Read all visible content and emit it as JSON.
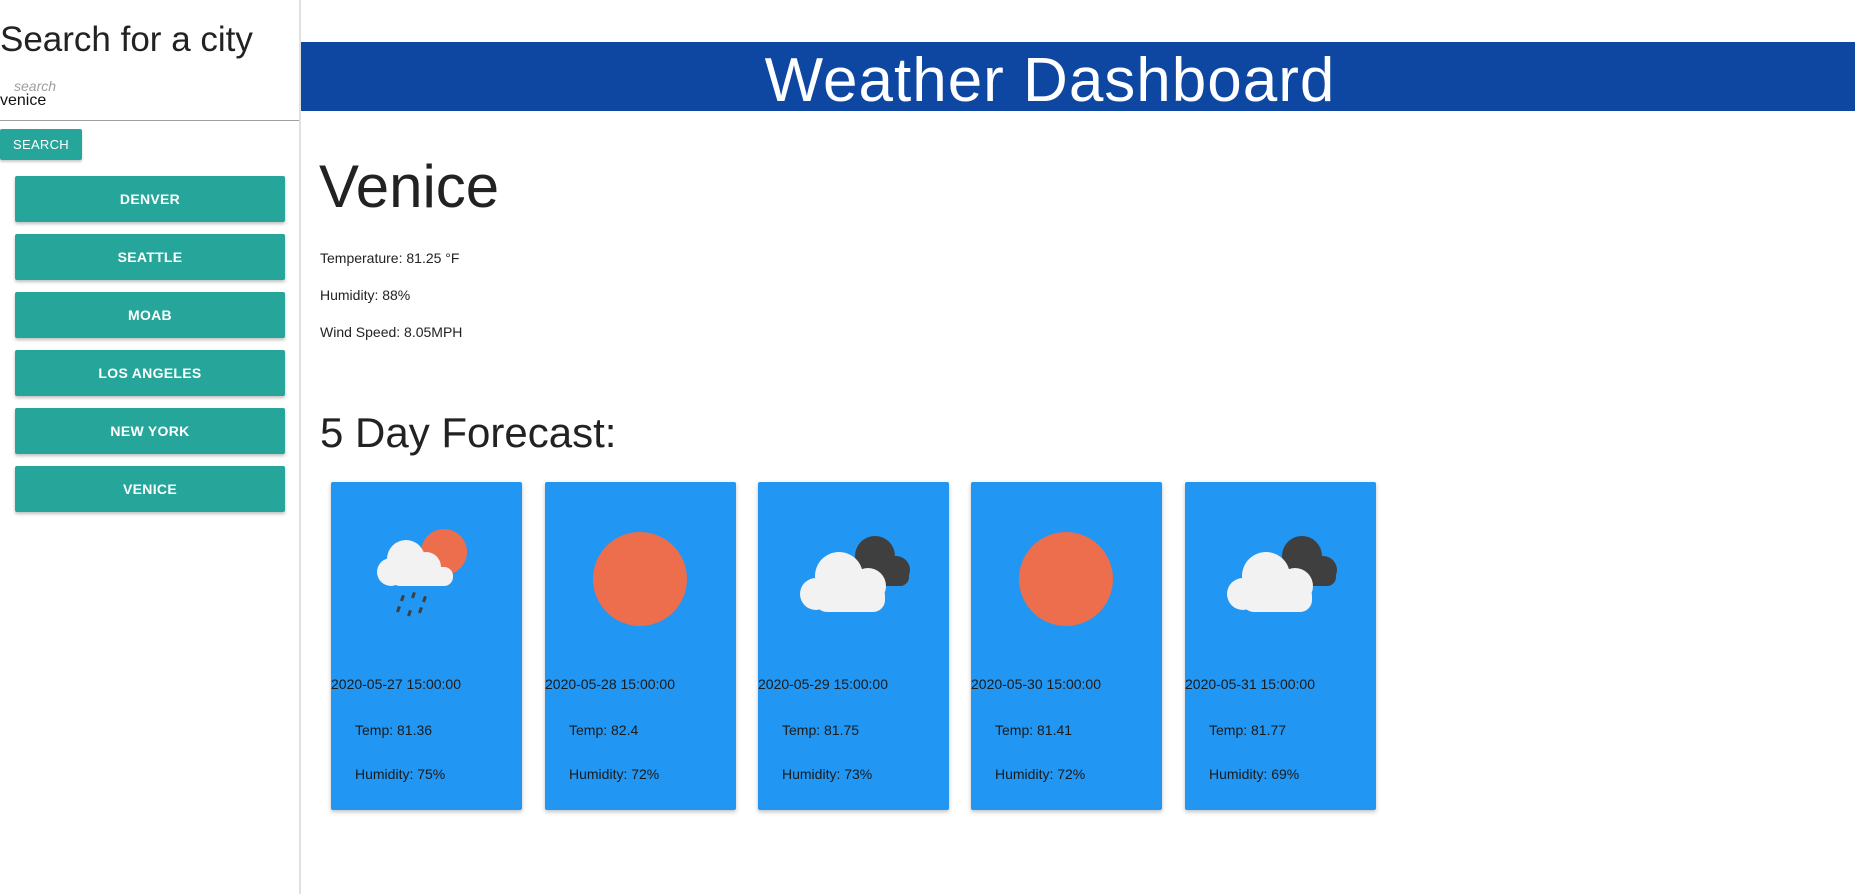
{
  "sidebar": {
    "title": "Search for a city",
    "search": {
      "placeholder": "search",
      "value": "venice"
    },
    "search_button": "SEARCH",
    "cities": [
      "DENVER",
      "SEATTLE",
      "MOAB",
      "LOS ANGELES",
      "NEW YORK",
      "VENICE"
    ]
  },
  "header": {
    "title": "Weather Dashboard"
  },
  "current": {
    "city": "Venice",
    "temperature": "Temperature: 81.25 °F",
    "humidity": "Humidity: 88%",
    "wind": "Wind Speed: 8.05MPH"
  },
  "forecast": {
    "title": "5 Day Forecast:",
    "days": [
      {
        "icon": "rain-cloud-sun-icon",
        "date": "2020-05-27 15:00:00",
        "temp": "Temp: 81.36",
        "humidity": "Humidity: 75%"
      },
      {
        "icon": "sun-icon",
        "date": "2020-05-28 15:00:00",
        "temp": "Temp: 82.4",
        "humidity": "Humidity: 72%"
      },
      {
        "icon": "broken-clouds-icon",
        "date": "2020-05-29 15:00:00",
        "temp": "Temp: 81.75",
        "humidity": "Humidity: 73%"
      },
      {
        "icon": "sun-icon",
        "date": "2020-05-30 15:00:00",
        "temp": "Temp: 81.41",
        "humidity": "Humidity: 72%"
      },
      {
        "icon": "broken-clouds-icon",
        "date": "2020-05-31 15:00:00",
        "temp": "Temp: 81.77",
        "humidity": "Humidity: 69%"
      }
    ]
  },
  "colors": {
    "header_bg": "#0d47a1",
    "button_bg": "#26a69a",
    "card_bg": "#2196f3",
    "sun": "#ec6e4c",
    "dark_cloud": "#3f3f3f",
    "light_cloud": "#f2f2f2"
  }
}
